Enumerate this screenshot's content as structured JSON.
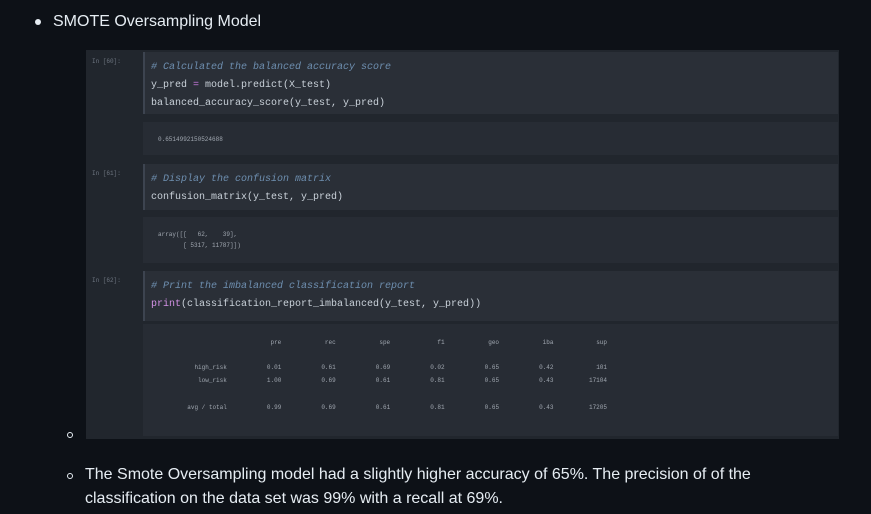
{
  "section_title": "SMOTE Oversampling Model",
  "cells": [
    {
      "prompt": "In [60]:",
      "lines": [
        {
          "comment": "# Calculated the balanced accuracy score"
        },
        {
          "a": "y_pred ",
          "op": "=",
          "b": " model.predict(X_test)"
        },
        {
          "plain": "balanced_accuracy_score(y_test, y_pred)"
        }
      ],
      "output": "0.6514992150524688"
    },
    {
      "prompt": "In [61]:",
      "lines": [
        {
          "comment": "# Display the confusion matrix"
        },
        {
          "plain": "confusion_matrix(y_test, y_pred)"
        }
      ],
      "output": "array([[   62,    39],\n       [ 5317, 11787]])"
    },
    {
      "prompt": "In [62]:",
      "lines": [
        {
          "comment": "# Print the imbalanced classification report"
        },
        {
          "fn": "print",
          "b": "(classification_report_imbalanced(y_test, y_pred))"
        }
      ],
      "report": {
        "headers": [
          "pre",
          "rec",
          "spe",
          "f1",
          "geo",
          "iba",
          "sup"
        ],
        "rows": [
          {
            "label": "high_risk",
            "values": [
              "0.01",
              "0.61",
              "0.69",
              "0.02",
              "0.65",
              "0.42",
              "101"
            ]
          },
          {
            "label": "low_risk",
            "values": [
              "1.00",
              "0.69",
              "0.61",
              "0.81",
              "0.65",
              "0.43",
              "17104"
            ]
          },
          {
            "label": "avg / total",
            "values": [
              "0.99",
              "0.69",
              "0.61",
              "0.81",
              "0.65",
              "0.43",
              "17205"
            ]
          }
        ]
      }
    }
  ],
  "summary": "The Smote Oversampling model had a slightly higher accuracy of 65%. The precision of of the classification on the data set was 99% with a recall at 69%."
}
